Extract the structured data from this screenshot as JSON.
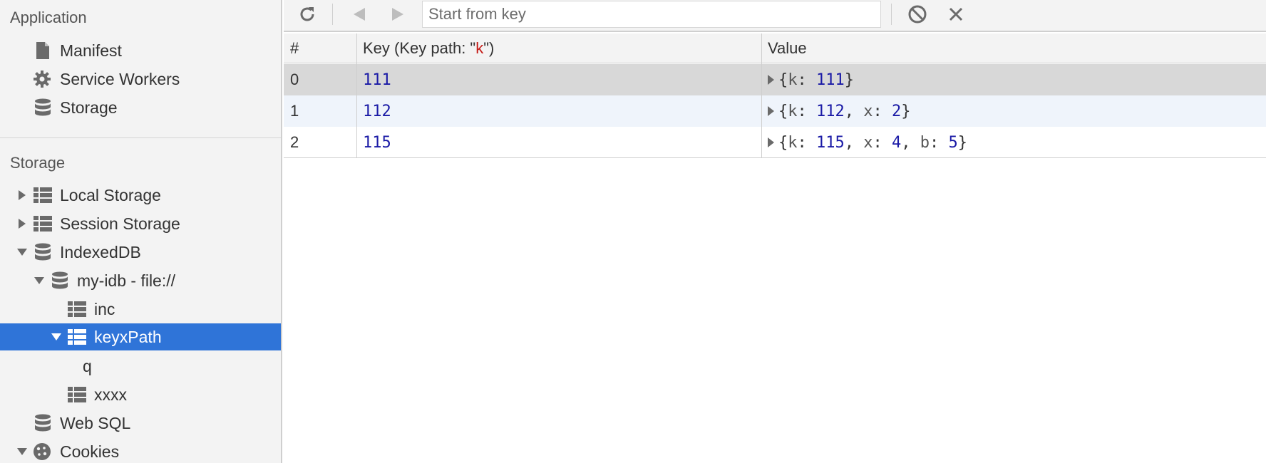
{
  "sidebar": {
    "application_title": "Application",
    "application_items": [
      {
        "label": "Manifest",
        "icon": "document-icon"
      },
      {
        "label": "Service Workers",
        "icon": "gear-icon"
      },
      {
        "label": "Storage",
        "icon": "database-icon"
      }
    ],
    "storage_title": "Storage",
    "storage_items": [
      {
        "label": "Local Storage",
        "icon": "table-grid-icon",
        "expanded": false
      },
      {
        "label": "Session Storage",
        "icon": "table-grid-icon",
        "expanded": false
      },
      {
        "label": "IndexedDB",
        "icon": "database-icon",
        "expanded": true
      },
      {
        "label": "my-idb - file://",
        "icon": "database-icon",
        "expanded": true
      },
      {
        "label": "inc",
        "icon": "table-grid-icon"
      },
      {
        "label": "keyxPath",
        "icon": "table-grid-icon",
        "expanded": true,
        "selected": true
      },
      {
        "label": "q"
      },
      {
        "label": "xxxx",
        "icon": "table-grid-icon"
      },
      {
        "label": "Web SQL",
        "icon": "database-icon"
      },
      {
        "label": "Cookies",
        "icon": "cookie-icon",
        "expanded": true
      }
    ]
  },
  "toolbar": {
    "refresh_icon": "refresh-icon",
    "prev_icon": "prev-page-icon",
    "next_icon": "next-page-icon",
    "start_key_placeholder": "Start from key",
    "clear_icon": "clear-icon",
    "delete_icon": "delete-icon"
  },
  "table": {
    "headers": {
      "index": "#",
      "key_prefix": "Key (Key path: \"",
      "key_path": "k",
      "key_suffix": "\")",
      "value": "Value"
    },
    "rows": [
      {
        "index": "0",
        "key": "111",
        "value": [
          {
            "k": "k",
            "v": "111"
          }
        ]
      },
      {
        "index": "1",
        "key": "112",
        "value": [
          {
            "k": "k",
            "v": "112"
          },
          {
            "k": "x",
            "v": "2"
          }
        ]
      },
      {
        "index": "2",
        "key": "115",
        "value": [
          {
            "k": "k",
            "v": "115"
          },
          {
            "k": "x",
            "v": "4"
          },
          {
            "k": "b",
            "v": "5"
          }
        ]
      }
    ]
  },
  "colors": {
    "selection": "#2f74d8",
    "number": "#1a1aa6",
    "key_path": "#c41a16",
    "selected_row": "#d8d8d8",
    "alt_row": "#eff4fb"
  }
}
